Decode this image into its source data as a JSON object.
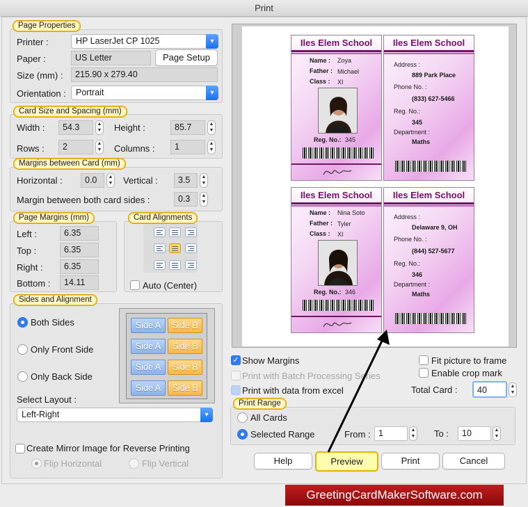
{
  "window": {
    "title": "Print"
  },
  "page_properties": {
    "title": "Page Properties",
    "printer_label": "Printer :",
    "printer_value": "HP LaserJet CP 1025",
    "paper_label": "Paper :",
    "paper_value": "US Letter",
    "page_setup_button": "Page Setup",
    "size_label": "Size (mm) :",
    "size_value": "215.90 x 279.40",
    "orientation_label": "Orientation :",
    "orientation_value": "Portrait"
  },
  "card_size": {
    "title": "Card Size and Spacing (mm)",
    "width_label": "Width :",
    "width_value": "54.3",
    "height_label": "Height :",
    "height_value": "85.7",
    "rows_label": "Rows :",
    "rows_value": "2",
    "columns_label": "Columns :",
    "columns_value": "1"
  },
  "margins_between": {
    "title": "Margins between Card (mm)",
    "horizontal_label": "Horizontal :",
    "horizontal_value": "0.0",
    "vertical_label": "Vertical :",
    "vertical_value": "3.5",
    "both_sides_label": "Margin between both card sides :",
    "both_sides_value": "0.3"
  },
  "page_margins": {
    "title": "Page Margins (mm)",
    "left_label": "Left :",
    "left_value": "6.35",
    "top_label": "Top :",
    "top_value": "6.35",
    "right_label": "Right :",
    "right_value": "6.35",
    "bottom_label": "Bottom :",
    "bottom_value": "14.11"
  },
  "card_alignments": {
    "title": "Card Alignments",
    "auto_center_label": "Auto (Center)",
    "selected": "middle-center"
  },
  "sides": {
    "title": "Sides and Alignment",
    "both_sides": "Both Sides",
    "front_only": "Only Front Side",
    "back_only": "Only Back Side",
    "selected": "both",
    "grid_side_a": "Side A",
    "grid_side_b": "Side B",
    "select_layout_label": "Select Layout :",
    "layout_value": "Left-Right",
    "mirror_label": "Create Mirror Image for Reverse Printing",
    "flip_h": "Flip Horizontal",
    "flip_v": "Flip Vertical"
  },
  "preview_cards": [
    {
      "school": "Iles Elem School",
      "name_label": "Name :",
      "name": "Zoya",
      "father_label": "Father :",
      "father": "Michael",
      "class_label": "Class :",
      "class": "XI",
      "reg_label": "Reg. No.:",
      "reg": "345",
      "back_address_label": "Address :",
      "back_address": "889 Park Place",
      "back_phone_label": "Phone No. :",
      "back_phone": "(833) 627-5466",
      "back_reg_label": "Reg. No.:",
      "back_reg": "345",
      "back_dept_label": "Department :",
      "back_dept": "Maths"
    },
    {
      "school": "Iles Elem School",
      "name_label": "Name :",
      "name": "Nina Soto",
      "father_label": "Father :",
      "father": "Tyler",
      "class_label": "Class :",
      "class": "XI",
      "reg_label": "Reg. No.:",
      "reg": "346",
      "back_address_label": "Address :",
      "back_address": "Delaware 9, OH",
      "back_phone_label": "Phone No. :",
      "back_phone": "(844) 527-5677",
      "back_reg_label": "Reg. No.:",
      "back_reg": "346",
      "back_dept_label": "Department :",
      "back_dept": "Maths"
    }
  ],
  "options": {
    "show_margins": "Show Margins",
    "batch_processing": "Print with Batch Processing Series",
    "print_excel": "Print with data from excel",
    "fit_picture": "Fit picture to frame",
    "crop_mark": "Enable crop mark",
    "total_card_label": "Total Card :",
    "total_card_value": "40"
  },
  "print_range": {
    "title": "Print Range",
    "all_cards": "All Cards",
    "selected_range": "Selected Range",
    "selected": "selected_range",
    "from_label": "From :",
    "from_value": "1",
    "to_label": "To :",
    "to_value": "10"
  },
  "buttons": {
    "help": "Help",
    "preview": "Preview",
    "print": "Print",
    "cancel": "Cancel"
  },
  "watermark": {
    "text": "GreetingCardMakerSoftware.com"
  },
  "colors": {
    "accent": "#2f7cf6",
    "title_highlight": "#fff6c2",
    "card_purple": "#7a0f6d",
    "watermark": "#b01414"
  }
}
